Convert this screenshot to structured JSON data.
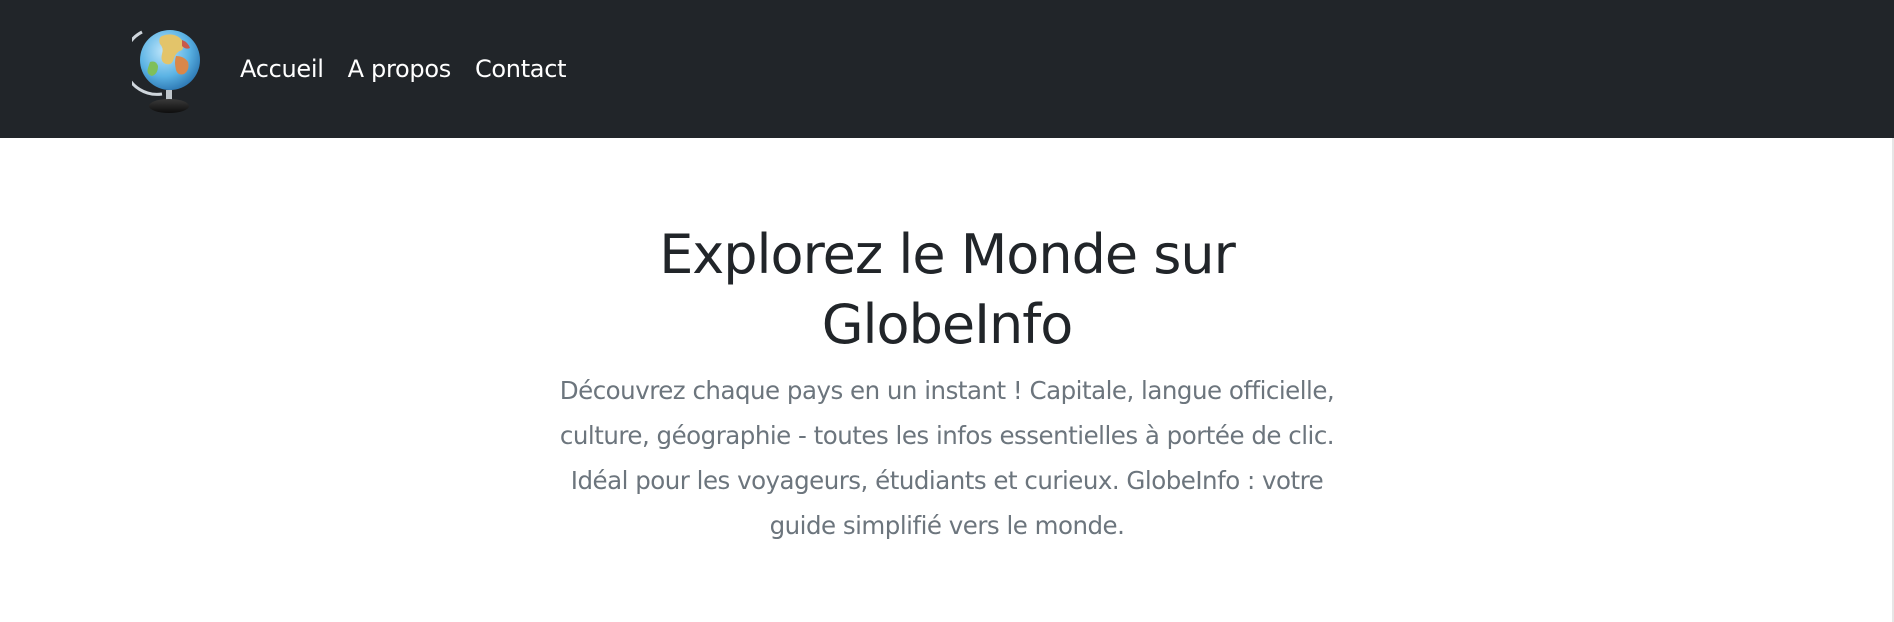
{
  "navbar": {
    "logo_icon": "globe-icon",
    "links": [
      {
        "label": "Accueil"
      },
      {
        "label": "A propos"
      },
      {
        "label": "Contact"
      }
    ],
    "background": "#212529"
  },
  "hero": {
    "title": "Explorez le Monde sur GlobeInfo",
    "lead": "Découvrez chaque pays en un instant ! Capitale, langue officielle, culture, géographie - toutes les infos essentielles à portée de clic. Idéal pour les voyageurs, étudiants et curieux. GlobeInfo : votre guide simplifié vers le monde.",
    "title_color": "#212529",
    "lead_color": "#6c757d"
  }
}
